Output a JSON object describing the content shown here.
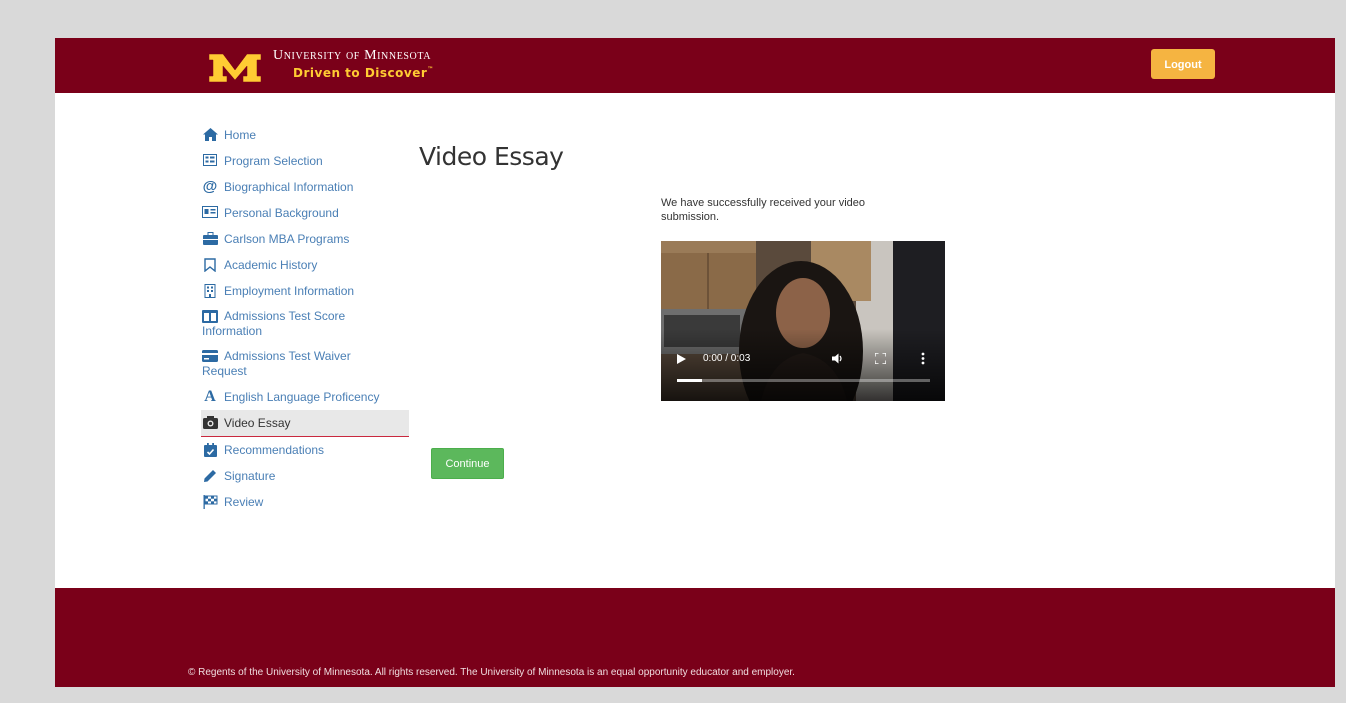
{
  "header": {
    "university_name": "University of Minnesota",
    "tagline": "Driven to Discover",
    "tagline_mark": "™",
    "logout_label": "Logout"
  },
  "sidebar": {
    "items": [
      {
        "label": "Home",
        "icon": "home-icon"
      },
      {
        "label": "Program Selection",
        "icon": "list-icon"
      },
      {
        "label": "Biographical Information",
        "icon": "at-icon"
      },
      {
        "label": "Personal Background",
        "icon": "id-card-icon"
      },
      {
        "label": "Carlson MBA Programs",
        "icon": "briefcase-icon"
      },
      {
        "label": "Academic History",
        "icon": "bookmark-icon"
      },
      {
        "label": "Employment Information",
        "icon": "building-icon"
      },
      {
        "label": "Admissions Test Score Information",
        "icon": "columns-icon"
      },
      {
        "label": "Admissions Test Waiver Request",
        "icon": "card-icon"
      },
      {
        "label": "English Language Proficency",
        "icon": "letter-a-icon"
      },
      {
        "label": "Video Essay",
        "icon": "camera-icon",
        "active": true
      },
      {
        "label": "Recommendations",
        "icon": "calendar-check-icon"
      },
      {
        "label": "Signature",
        "icon": "pencil-icon"
      },
      {
        "label": "Review",
        "icon": "checkered-flag-icon"
      }
    ]
  },
  "main": {
    "title": "Video Essay",
    "status_message": "We have successfully received your video submission.",
    "video": {
      "time": "0:00 / 0:03",
      "progress": 0.1
    },
    "continue_label": "Continue"
  },
  "footer": {
    "text": "© Regents of the University of Minnesota. All rights reserved. The University of Minnesota is an equal opportunity educator and employer."
  },
  "colors": {
    "maroon": "#7a0019",
    "gold": "#ffcc33",
    "logout": "#f5b441",
    "link": "#4a7fb5",
    "continue": "#5cb85c"
  }
}
